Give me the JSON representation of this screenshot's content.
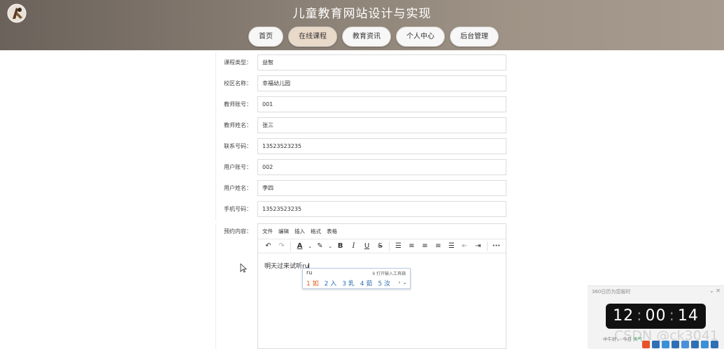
{
  "header": {
    "title": "儿童教育网站设计与实现",
    "nav": [
      {
        "label": "首页",
        "active": false
      },
      {
        "label": "在线课程",
        "active": true
      },
      {
        "label": "教育资讯",
        "active": false
      },
      {
        "label": "个人中心",
        "active": false
      },
      {
        "label": "后台管理",
        "active": false
      }
    ]
  },
  "form": {
    "fields": [
      {
        "label": "课程类型：",
        "value": "益智"
      },
      {
        "label": "校区名称：",
        "value": "幸福幼儿园"
      },
      {
        "label": "教师账号：",
        "value": "001"
      },
      {
        "label": "教师姓名：",
        "value": "张三"
      },
      {
        "label": "联系号码：",
        "value": "13523523235"
      },
      {
        "label": "用户账号：",
        "value": "002"
      },
      {
        "label": "用户姓名：",
        "value": "李四"
      },
      {
        "label": "手机号码：",
        "value": "13523523235"
      }
    ],
    "editor_label": "预约内容：",
    "editor": {
      "menu": [
        "文件",
        "编辑",
        "插入",
        "格式",
        "表格"
      ],
      "content": "明天过来试听ru"
    }
  },
  "ime": {
    "input": "ru",
    "hint": "9 打开输入工具箱",
    "candidates": [
      "1 如",
      "2 入",
      "3 乳",
      "4 茹",
      "5 汝"
    ],
    "arrows": "› ⌄"
  },
  "timer": {
    "title": "360日历为您报时",
    "hours": "12",
    "minutes": "00",
    "seconds": "14",
    "foot_left": "中午好，",
    "foot_mid": "今日",
    "foot_right": "天气"
  },
  "watermark": "CSDN @ck3041",
  "colors": {
    "header_start": "#6b625b",
    "header_end": "#a79b8f",
    "nav_active": "#e9d9c9",
    "ime_first": "#e05a1a",
    "ime_other": "#2f6fb3"
  }
}
